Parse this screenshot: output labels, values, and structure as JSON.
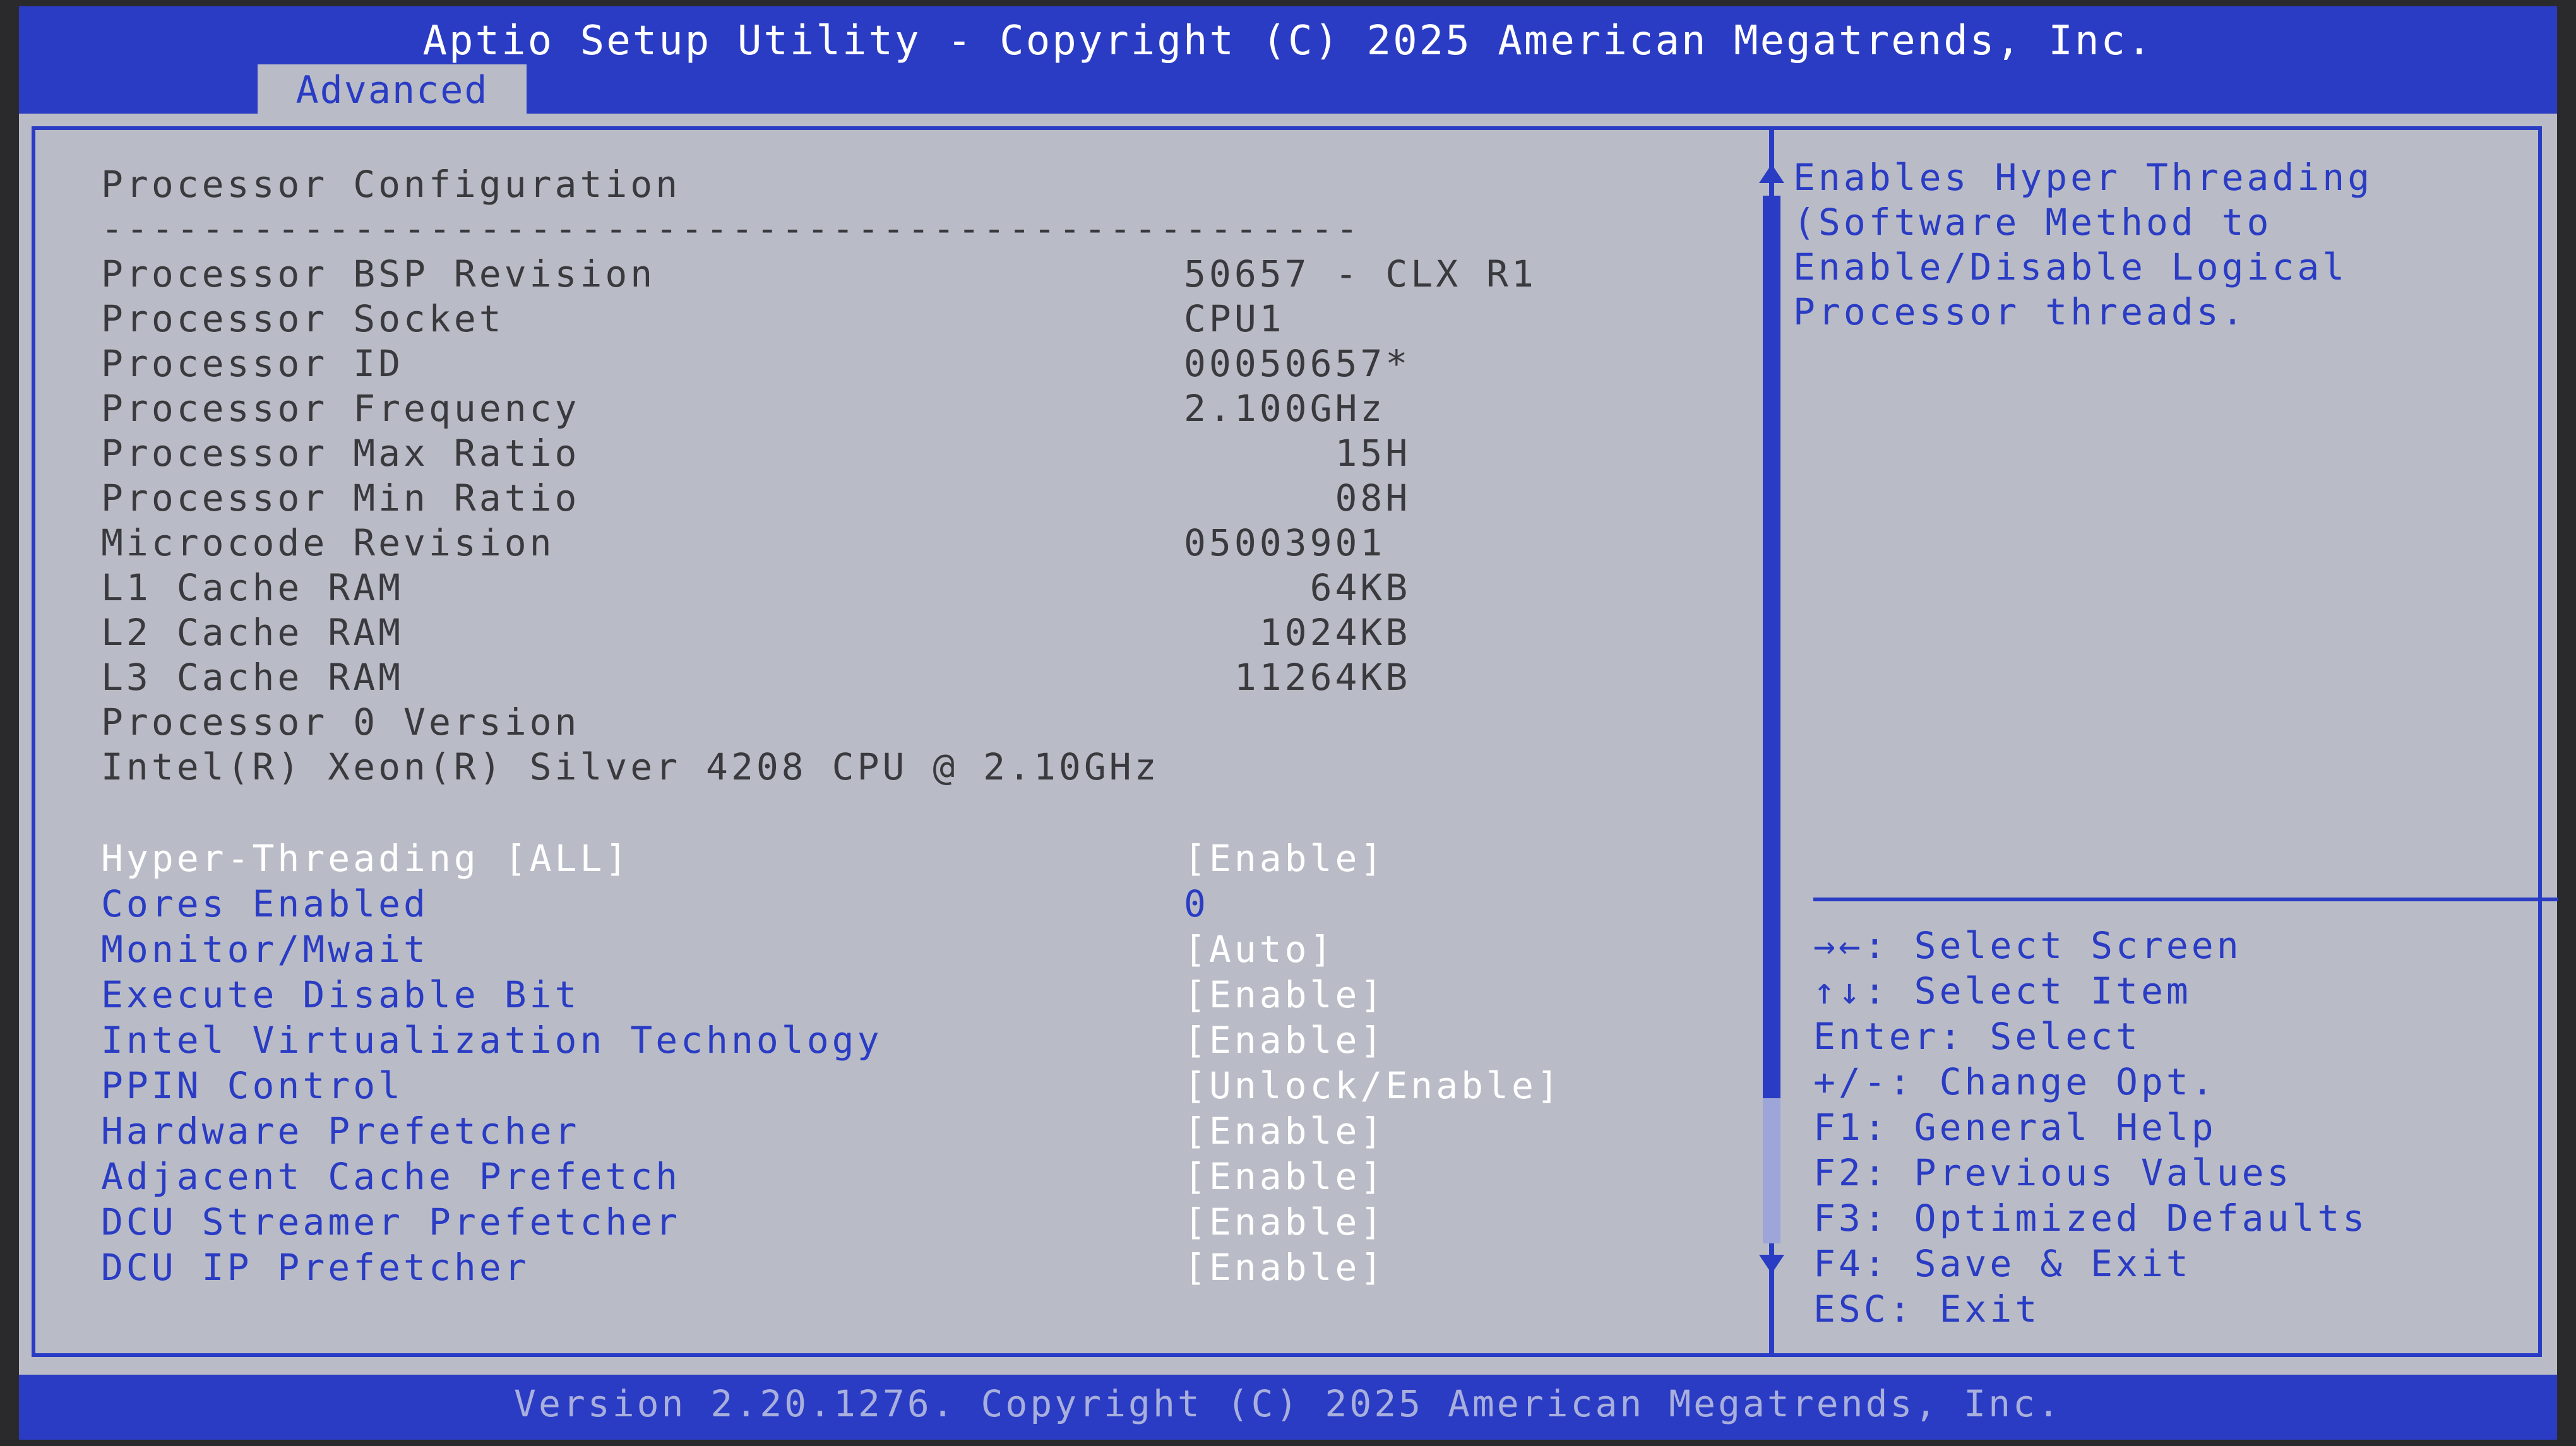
{
  "header": {
    "title": "Aptio Setup Utility - Copyright (C) 2025 American Megatrends, Inc.",
    "tab": "Advanced"
  },
  "section": {
    "title": "Processor Configuration",
    "separator": "--------------------------------------------------"
  },
  "info_rows": [
    {
      "label": "Processor BSP Revision",
      "value": "50657 - CLX R1"
    },
    {
      "label": "Processor Socket",
      "value": "CPU1"
    },
    {
      "label": "Processor ID",
      "value": "00050657*"
    },
    {
      "label": "Processor Frequency",
      "value": "2.100GHz"
    },
    {
      "label": "Processor Max Ratio",
      "value": "      15H"
    },
    {
      "label": "Processor Min Ratio",
      "value": "      08H"
    },
    {
      "label": "Microcode Revision",
      "value": "05003901"
    },
    {
      "label": "L1 Cache RAM",
      "value": "     64KB"
    },
    {
      "label": "L2 Cache RAM",
      "value": "   1024KB"
    },
    {
      "label": "L3 Cache RAM",
      "value": "  11264KB"
    },
    {
      "label": "Processor 0 Version",
      "value": ""
    },
    {
      "label": "Intel(R) Xeon(R) Silver 4208 CPU @ 2.10GHz",
      "value": ""
    }
  ],
  "options": [
    {
      "label": "Hyper-Threading [ALL]",
      "value": "[Enable]"
    },
    {
      "label": "Cores Enabled",
      "value": "0"
    },
    {
      "label": "Monitor/Mwait",
      "value": "[Auto]"
    },
    {
      "label": "Execute Disable Bit",
      "value": "[Enable]"
    },
    {
      "label": "Intel Virtualization Technology",
      "value": "[Enable]"
    },
    {
      "label": "PPIN Control",
      "value": "[Unlock/Enable]"
    },
    {
      "label": "Hardware Prefetcher",
      "value": "[Enable]"
    },
    {
      "label": "Adjacent Cache Prefetch",
      "value": "[Enable]"
    },
    {
      "label": "DCU Streamer Prefetcher",
      "value": "[Enable]"
    },
    {
      "label": "DCU IP Prefetcher",
      "value": "[Enable]"
    }
  ],
  "help": {
    "lines": [
      "Enables Hyper Threading",
      "(Software Method to",
      "Enable/Disable Logical",
      "Processor threads."
    ]
  },
  "keys": [
    "→←: Select Screen",
    "↑↓: Select Item",
    "Enter: Select",
    "+/-: Change Opt.",
    "F1: General Help",
    "F2: Previous Values",
    "F3: Optimized Defaults",
    "F4: Save & Exit",
    "ESC: Exit"
  ],
  "footer": {
    "version": "Version 2.20.1276. Copyright (C) 2025 American Megatrends, Inc."
  },
  "colors": {
    "bios_blue": "#2a3cc4",
    "panel_gray": "#b9bcc6",
    "text_dark": "#3a3a3e"
  }
}
